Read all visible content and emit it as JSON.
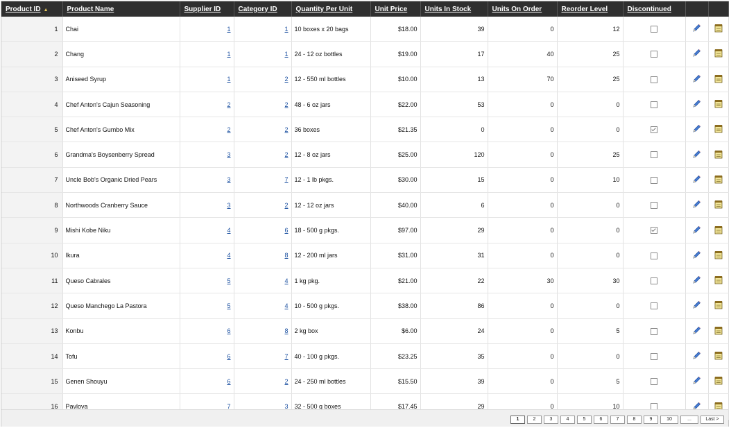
{
  "grid": {
    "columns": [
      {
        "label": "Product ID",
        "sorted": true
      },
      {
        "label": "Product Name"
      },
      {
        "label": "Supplier ID"
      },
      {
        "label": "Category ID"
      },
      {
        "label": "Quantity Per Unit"
      },
      {
        "label": "Unit Price"
      },
      {
        "label": "Units In Stock"
      },
      {
        "label": "Units On Order"
      },
      {
        "label": "Reorder Level"
      },
      {
        "label": "Discontinued"
      }
    ],
    "sort_indicator": "▲",
    "rows": [
      {
        "id": "1",
        "name": "Chai",
        "supplier": "1",
        "category": "1",
        "qty": "10 boxes x 20 bags",
        "price": "$18.00",
        "stock": "39",
        "order": "0",
        "reorder": "12",
        "discontinued": false
      },
      {
        "id": "2",
        "name": "Chang",
        "supplier": "1",
        "category": "1",
        "qty": "24 - 12 oz bottles",
        "price": "$19.00",
        "stock": "17",
        "order": "40",
        "reorder": "25",
        "discontinued": false
      },
      {
        "id": "3",
        "name": "Aniseed Syrup",
        "supplier": "1",
        "category": "2",
        "qty": "12 - 550 ml bottles",
        "price": "$10.00",
        "stock": "13",
        "order": "70",
        "reorder": "25",
        "discontinued": false
      },
      {
        "id": "4",
        "name": "Chef Anton's Cajun Seasoning",
        "supplier": "2",
        "category": "2",
        "qty": "48 - 6 oz jars",
        "price": "$22.00",
        "stock": "53",
        "order": "0",
        "reorder": "0",
        "discontinued": false
      },
      {
        "id": "5",
        "name": "Chef Anton's Gumbo Mix",
        "supplier": "2",
        "category": "2",
        "qty": "36 boxes",
        "price": "$21.35",
        "stock": "0",
        "order": "0",
        "reorder": "0",
        "discontinued": true
      },
      {
        "id": "6",
        "name": "Grandma's Boysenberry Spread",
        "supplier": "3",
        "category": "2",
        "qty": "12 - 8 oz jars",
        "price": "$25.00",
        "stock": "120",
        "order": "0",
        "reorder": "25",
        "discontinued": false
      },
      {
        "id": "7",
        "name": "Uncle Bob's Organic Dried Pears",
        "supplier": "3",
        "category": "7",
        "qty": "12 - 1 lb pkgs.",
        "price": "$30.00",
        "stock": "15",
        "order": "0",
        "reorder": "10",
        "discontinued": false
      },
      {
        "id": "8",
        "name": "Northwoods Cranberry Sauce",
        "supplier": "3",
        "category": "2",
        "qty": "12 - 12 oz jars",
        "price": "$40.00",
        "stock": "6",
        "order": "0",
        "reorder": "0",
        "discontinued": false
      },
      {
        "id": "9",
        "name": "Mishi Kobe Niku",
        "supplier": "4",
        "category": "6",
        "qty": "18 - 500 g pkgs.",
        "price": "$97.00",
        "stock": "29",
        "order": "0",
        "reorder": "0",
        "discontinued": true
      },
      {
        "id": "10",
        "name": "Ikura",
        "supplier": "4",
        "category": "8",
        "qty": "12 - 200 ml jars",
        "price": "$31.00",
        "stock": "31",
        "order": "0",
        "reorder": "0",
        "discontinued": false
      },
      {
        "id": "11",
        "name": "Queso Cabrales",
        "supplier": "5",
        "category": "4",
        "qty": "1 kg pkg.",
        "price": "$21.00",
        "stock": "22",
        "order": "30",
        "reorder": "30",
        "discontinued": false
      },
      {
        "id": "12",
        "name": "Queso Manchego La Pastora",
        "supplier": "5",
        "category": "4",
        "qty": "10 - 500 g pkgs.",
        "price": "$38.00",
        "stock": "86",
        "order": "0",
        "reorder": "0",
        "discontinued": false
      },
      {
        "id": "13",
        "name": "Konbu",
        "supplier": "6",
        "category": "8",
        "qty": "2 kg box",
        "price": "$6.00",
        "stock": "24",
        "order": "0",
        "reorder": "5",
        "discontinued": false
      },
      {
        "id": "14",
        "name": "Tofu",
        "supplier": "6",
        "category": "7",
        "qty": "40 - 100 g pkgs.",
        "price": "$23.25",
        "stock": "35",
        "order": "0",
        "reorder": "0",
        "discontinued": false
      },
      {
        "id": "15",
        "name": "Genen Shouyu",
        "supplier": "6",
        "category": "2",
        "qty": "24 - 250 ml bottles",
        "price": "$15.50",
        "stock": "39",
        "order": "0",
        "reorder": "5",
        "discontinued": false
      },
      {
        "id": "16",
        "name": "Pavlova",
        "supplier": "7",
        "category": "3",
        "qty": "32 - 500 g boxes",
        "price": "$17.45",
        "stock": "29",
        "order": "0",
        "reorder": "10",
        "discontinued": false
      }
    ],
    "row_icons": {
      "edit": "pencil-icon",
      "delete": "notepad-icon"
    }
  },
  "pager": {
    "pages": [
      "1",
      "2",
      "3",
      "4",
      "5",
      "6",
      "7",
      "8",
      "9",
      "10"
    ],
    "current": "1",
    "ellipsis": "...",
    "last": "Last >"
  },
  "colors": {
    "header_bg": "#2f2f2f",
    "header_text": "#ffffff",
    "link": "#1a4fa0",
    "id_cell_bg": "#f3f3f3",
    "sort_arrow": "#e6c65a"
  }
}
